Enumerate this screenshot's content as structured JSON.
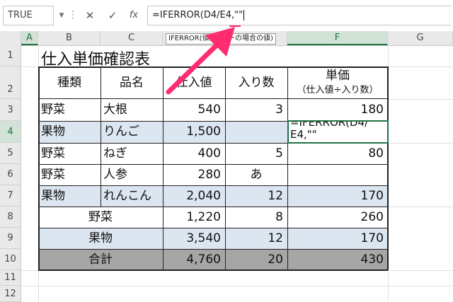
{
  "formula_bar": {
    "name_box": "TRUE",
    "dots": "⋮",
    "cancel_label": "✕",
    "enter_label": "✓",
    "function_label": "fx",
    "formula": "=IFERROR(D4/E4,\"\"",
    "tooltip": "IFERROR(値, エラーの場合の値)"
  },
  "columns": [
    "A",
    "B",
    "C",
    "D",
    "E",
    "F",
    "G"
  ],
  "rows": [
    "1",
    "2",
    "3",
    "4",
    "5",
    "6",
    "7",
    "8",
    "9",
    "10",
    "11",
    "12"
  ],
  "title": "仕入単価確認表",
  "headers": {
    "type": "種類",
    "name": "品名",
    "cost": "仕入値",
    "qty": "入り数",
    "unit_price": "単価",
    "unit_price_note": "（仕入値÷入り数）"
  },
  "table": [
    {
      "type": "野菜",
      "name": "大根",
      "cost": "540",
      "qty": "3",
      "unit": "180"
    },
    {
      "type": "果物",
      "name": "りんご",
      "cost": "1,500",
      "qty": "",
      "unit": ""
    },
    {
      "type": "野菜",
      "name": "ねぎ",
      "cost": "400",
      "qty": "5",
      "unit": "80"
    },
    {
      "type": "野菜",
      "name": "人参",
      "cost": "280",
      "qty": "あ",
      "unit": ""
    },
    {
      "type": "果物",
      "name": "れんこん",
      "cost": "2,040",
      "qty": "12",
      "unit": "170"
    }
  ],
  "editing_cell": {
    "line1": "=IFERROR(D4/",
    "line2": "E4,\"\""
  },
  "summary": [
    {
      "label": "野菜",
      "cost": "1,220",
      "qty": "8",
      "unit": "260"
    },
    {
      "label": "果物",
      "cost": "3,540",
      "qty": "12",
      "unit": "170"
    },
    {
      "label": "合計",
      "cost": "4,760",
      "qty": "20",
      "unit": "430"
    }
  ],
  "colors": {
    "arrow": "#ff2d6f",
    "blue_fill": "#dce6f1",
    "gray_fill": "#a6a6a6",
    "excel_green": "#217346"
  }
}
